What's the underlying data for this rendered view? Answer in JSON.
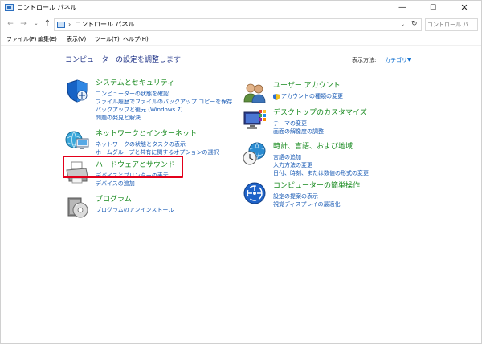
{
  "window": {
    "title": "コントロール パネル"
  },
  "titlebar": {
    "minimize": "—",
    "maximize": "☐",
    "close": "✕"
  },
  "nav": {
    "back": "←",
    "forward": "→",
    "history": "⌄",
    "up": "↑"
  },
  "address": {
    "separator": "›",
    "path": "コントロール パネル",
    "dropdown": "⌄",
    "refresh": "↻"
  },
  "search": {
    "placeholder": "コントロール パ..."
  },
  "menu": [
    "ファイル(F)",
    "編集(E)",
    "表示(V)",
    "ツール(T)",
    "ヘルプ(H)"
  ],
  "content": {
    "title": "コンピューターの設定を調整します",
    "view_by_label": "表示方法:",
    "view_by_value": "カテゴリ",
    "view_by_arrow": "▼"
  },
  "categories_left": [
    {
      "title": "システムとセキュリティ",
      "links": [
        "コンピューターの状態を確認",
        "ファイル履歴でファイルのバックアップ コピーを保存",
        "バックアップと復元 (Windows 7)",
        "問題の発見と解決"
      ]
    },
    {
      "title": "ネットワークとインターネット",
      "links": [
        "ネットワークの状態とタスクの表示",
        "ホームグループと共有に関するオプションの選択"
      ]
    },
    {
      "title": "ハードウェアとサウンド",
      "links": [
        "デバイスとプリンターの表示",
        "デバイスの追加"
      ]
    },
    {
      "title": "プログラム",
      "links": [
        "プログラムのアンインストール"
      ]
    }
  ],
  "categories_right": [
    {
      "title": "ユーザー アカウント",
      "links": [
        "アカウントの種類の変更"
      ]
    },
    {
      "title": "デスクトップのカスタマイズ",
      "links": [
        "テーマの変更",
        "画面の解像度の調整"
      ]
    },
    {
      "title": "時計、言語、および地域",
      "links": [
        "言語の追加",
        "入力方法の変更",
        "日付、時刻、または数値の形式の変更"
      ]
    },
    {
      "title": "コンピューターの簡単操作",
      "links": [
        "設定の提案の表示",
        "視覚ディスプレイの最適化"
      ]
    }
  ],
  "colors": {
    "heading": "#178a1e",
    "link": "#1a5bb5",
    "title": "#1e3287",
    "highlight": "#e3001b"
  }
}
